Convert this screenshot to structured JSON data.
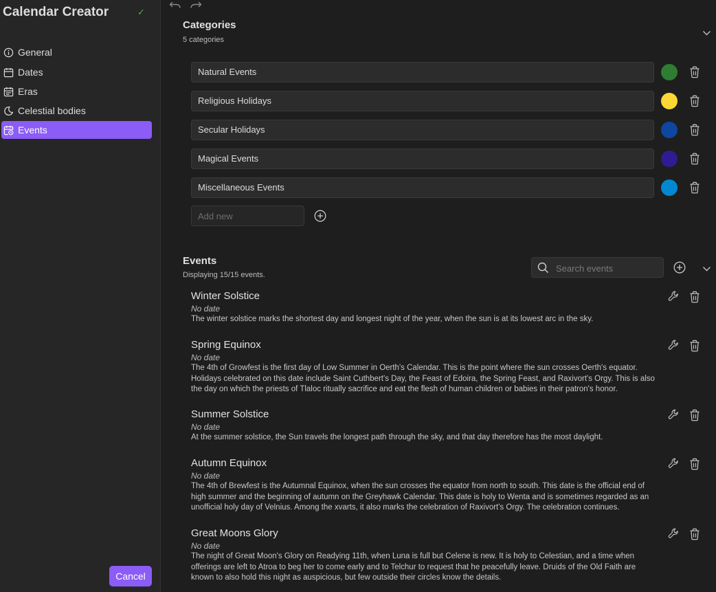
{
  "sidebar": {
    "title": "Calendar Creator",
    "items": [
      {
        "label": "General",
        "icon": "info-icon"
      },
      {
        "label": "Dates",
        "icon": "calendar-icon"
      },
      {
        "label": "Eras",
        "icon": "calendar-range-icon"
      },
      {
        "label": "Celestial bodies",
        "icon": "moon-icon"
      },
      {
        "label": "Events",
        "icon": "calendar-clock-icon",
        "active": true
      }
    ],
    "cancel_label": "Cancel"
  },
  "categories": {
    "title": "Categories",
    "subtitle": "5 categories",
    "items": [
      {
        "name": "Natural Events",
        "color": "#2e7d32"
      },
      {
        "name": "Religious Holidays",
        "color": "#fdd835"
      },
      {
        "name": "Secular Holidays",
        "color": "#0d47a1"
      },
      {
        "name": "Magical Events",
        "color": "#311b92"
      },
      {
        "name": "Miscellaneous Events",
        "color": "#0288d1"
      }
    ],
    "add_placeholder": "Add new"
  },
  "events": {
    "title": "Events",
    "subtitle": "Displaying 15/15 events.",
    "search_placeholder": "Search events",
    "items": [
      {
        "name": "Winter Solstice",
        "date": "No date",
        "description": "The winter solstice marks the shortest day and longest night of the year, when the sun is at its lowest arc in the sky."
      },
      {
        "name": "Spring Equinox",
        "date": "No date",
        "description": "The 4th of Growfest is the first day of Low Summer in Oerth's Calendar. This is the point where the sun crosses Oerth's equator. Holidays celebrated on this date include Saint Cuthbert's Day, the Feast of Edoira, the Spring Feast, and Raxivort's Orgy. This is also the day on which the priests of Tlaloc ritually sacrifice and eat the flesh of human children or babies in their patron's honor."
      },
      {
        "name": "Summer Solstice",
        "date": "No date",
        "description": "At the summer solstice, the Sun travels the longest path through the sky, and that day therefore has the most daylight."
      },
      {
        "name": "Autumn Equinox",
        "date": "No date",
        "description": "The 4th of Brewfest is the Autumnal Equinox, when the sun crosses the equator from north to south. This date is the official end of high summer and the beginning of autumn on the Greyhawk Calendar. This date is holy to Wenta and is sometimes regarded as an unofficial holy day of Velnius. Among the xvarts, it also marks the celebration of Raxivort's Orgy. The celebration continues."
      },
      {
        "name": "Great Moons Glory",
        "date": "No date",
        "description": "The night of Great Moon's Glory on Readying 11th, when Luna is full but Celene is new. It is holy to Celestian, and a time when offerings are left to Atroa to beg her to come early and to Telchur to request that he peacefully leave. Druids of the Old Faith are known to also hold this night as auspicious, but few outside their circles know the details."
      }
    ]
  },
  "colors": {
    "accent": "#8b5cf6",
    "success": "#4caf50"
  }
}
